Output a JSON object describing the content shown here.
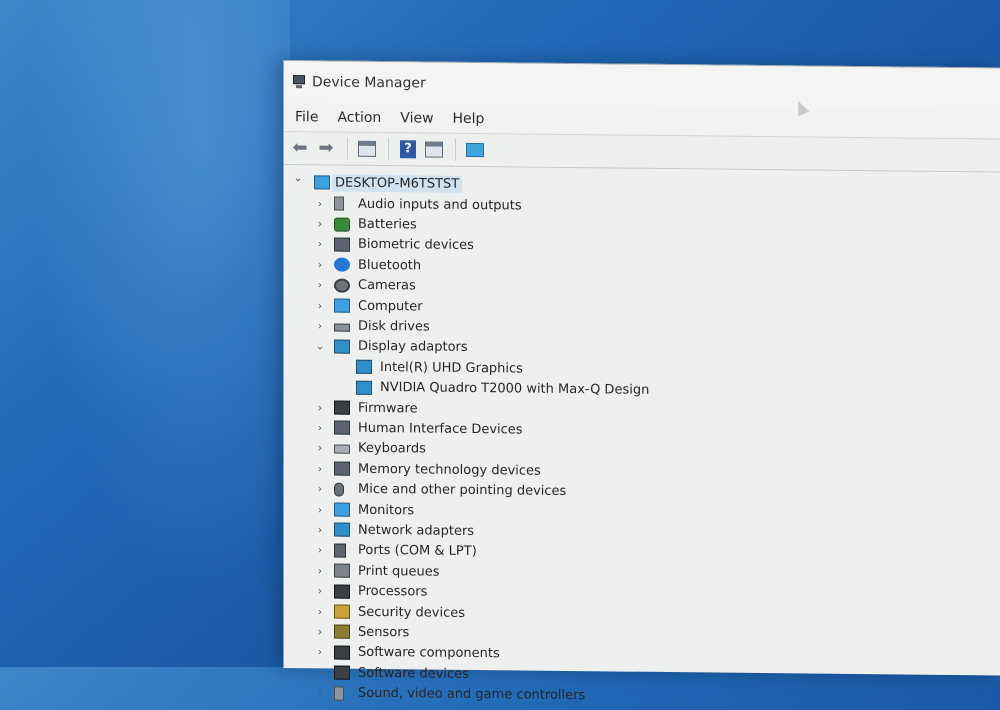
{
  "window": {
    "title": "Device Manager",
    "title_icon": "device-manager-icon"
  },
  "menu": [
    "File",
    "Action",
    "View",
    "Help"
  ],
  "toolbar": {
    "back_icon": "arrow-left-icon",
    "forward_icon": "arrow-right-icon",
    "properties_icon": "properties-icon",
    "help_icon": "help-icon",
    "help_label": "?",
    "update_driver_icon": "update-driver-icon",
    "scan_icon": "scan-hardware-icon"
  },
  "tree": {
    "root": "DESKTOP-M6TSTST",
    "categories": [
      {
        "label": "Audio inputs and outputs",
        "icon": "speaker-icon",
        "expanded": false
      },
      {
        "label": "Batteries",
        "icon": "battery-icon",
        "expanded": false
      },
      {
        "label": "Biometric devices",
        "icon": "biometric-icon",
        "expanded": false
      },
      {
        "label": "Bluetooth",
        "icon": "bluetooth-icon",
        "expanded": false
      },
      {
        "label": "Cameras",
        "icon": "camera-icon",
        "expanded": false
      },
      {
        "label": "Computer",
        "icon": "computer-icon",
        "expanded": false
      },
      {
        "label": "Disk drives",
        "icon": "disk-drive-icon",
        "expanded": false
      },
      {
        "label": "Display adaptors",
        "icon": "display-adapter-icon",
        "expanded": true,
        "children": [
          "Intel(R) UHD Graphics",
          "NVIDIA Quadro T2000 with Max-Q Design"
        ]
      },
      {
        "label": "Firmware",
        "icon": "firmware-icon",
        "expanded": false
      },
      {
        "label": "Human Interface Devices",
        "icon": "hid-icon",
        "expanded": false
      },
      {
        "label": "Keyboards",
        "icon": "keyboard-icon",
        "expanded": false
      },
      {
        "label": "Memory technology devices",
        "icon": "memory-icon",
        "expanded": false
      },
      {
        "label": "Mice and other pointing devices",
        "icon": "mouse-icon",
        "expanded": false
      },
      {
        "label": "Monitors",
        "icon": "monitor-icon",
        "expanded": false
      },
      {
        "label": "Network adapters",
        "icon": "network-adapter-icon",
        "expanded": false
      },
      {
        "label": "Ports (COM & LPT)",
        "icon": "port-icon",
        "expanded": false
      },
      {
        "label": "Print queues",
        "icon": "printer-icon",
        "expanded": false
      },
      {
        "label": "Processors",
        "icon": "processor-icon",
        "expanded": false
      },
      {
        "label": "Security devices",
        "icon": "security-icon",
        "expanded": false
      },
      {
        "label": "Sensors",
        "icon": "sensor-icon",
        "expanded": false
      },
      {
        "label": "Software components",
        "icon": "software-component-icon",
        "expanded": false
      },
      {
        "label": "Software devices",
        "icon": "software-device-icon",
        "expanded": false
      },
      {
        "label": "Sound, video and game controllers",
        "icon": "sound-icon",
        "expanded": false
      }
    ]
  },
  "colors": {
    "desktop": "#1f66b4",
    "window_bg": "#eef0ef",
    "root_highlight": "#cfe3f3"
  }
}
